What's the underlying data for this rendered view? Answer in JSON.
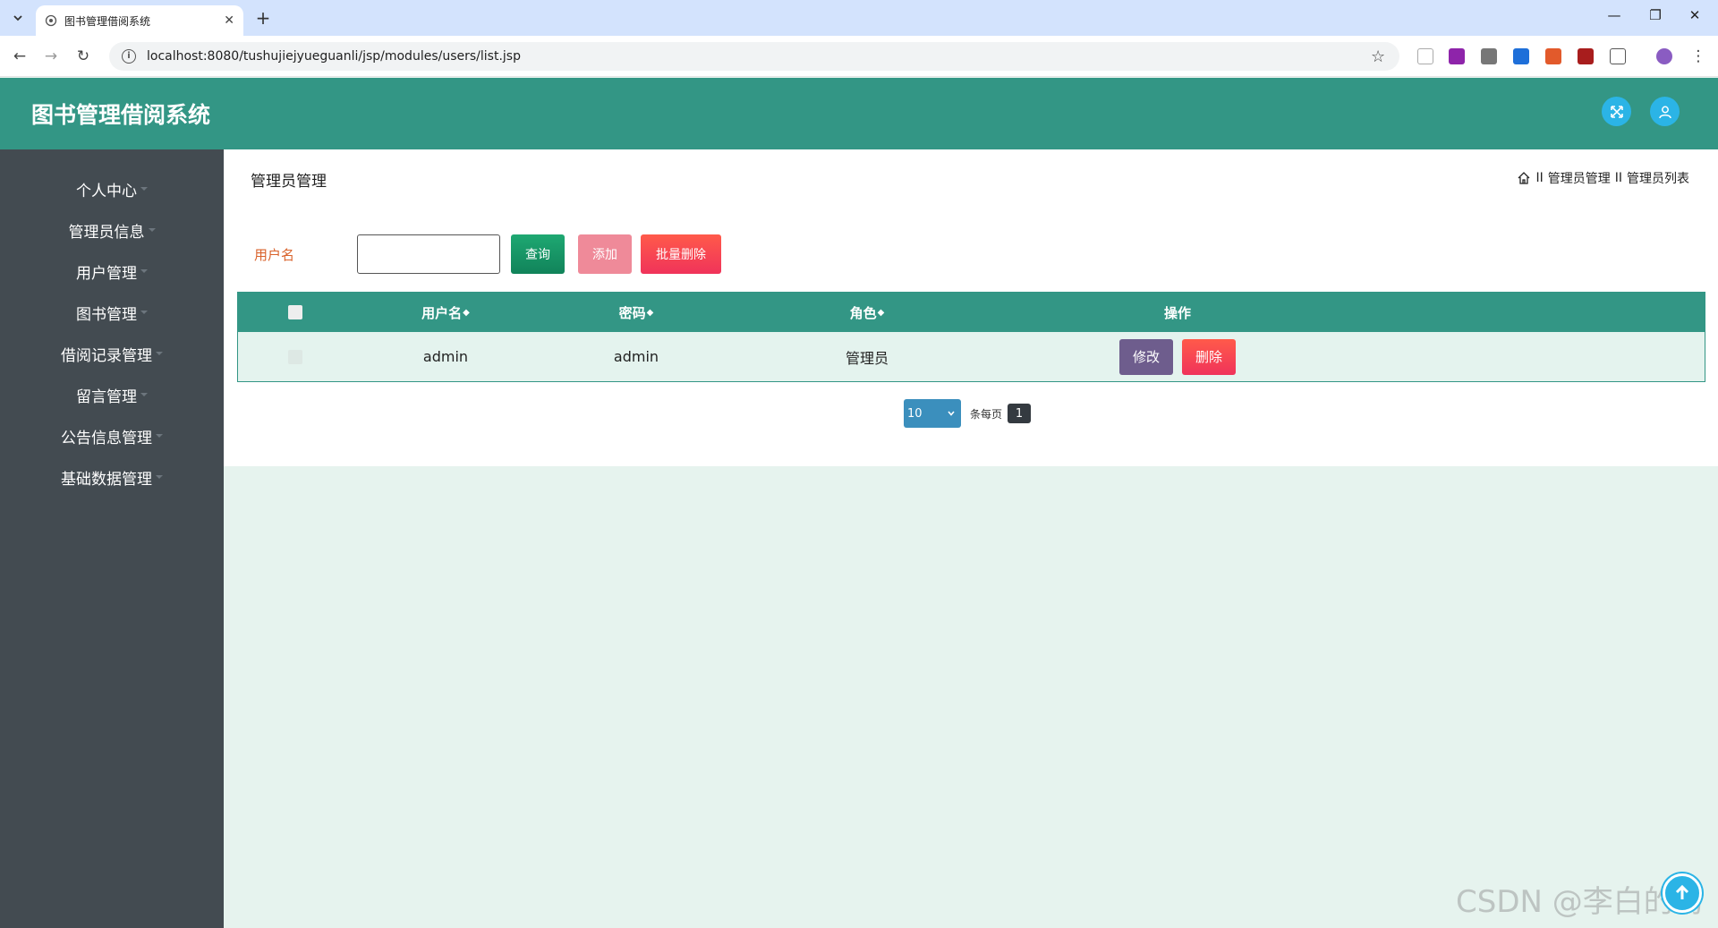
{
  "browser": {
    "tab_title": "图书管理借阅系统",
    "tab_close": "✕",
    "new_tab": "+",
    "url": "localhost:8080/tushujiejyueguanli/jsp/modules/users/list.jsp",
    "minimize": "—",
    "restore": "❐",
    "close": "✕"
  },
  "app": {
    "title": "图书管理借阅系统",
    "accent_color": "#339685",
    "sidebar_color": "#434b51"
  },
  "sidebar": {
    "items": [
      {
        "label": "个人中心"
      },
      {
        "label": "管理员信息"
      },
      {
        "label": "用户管理"
      },
      {
        "label": "图书管理"
      },
      {
        "label": "借阅记录管理"
      },
      {
        "label": "留言管理"
      },
      {
        "label": "公告信息管理"
      },
      {
        "label": "基础数据管理"
      }
    ]
  },
  "page": {
    "title": "管理员管理",
    "breadcrumb": [
      "管理员管理",
      "管理员列表"
    ],
    "breadcrumb_sep": "II"
  },
  "search": {
    "label": "用户名",
    "value": "",
    "query_label": "查询",
    "add_label": "添加",
    "batch_delete_label": "批量删除"
  },
  "table": {
    "columns": [
      "用户名",
      "密码",
      "角色",
      "操作"
    ],
    "sort_icon": "◆",
    "rows": [
      {
        "username": "admin",
        "password": "admin",
        "role": "管理员"
      }
    ],
    "edit_label": "修改",
    "delete_label": "删除"
  },
  "pager": {
    "page_size": "10",
    "per_page_label": "条每页",
    "current_page": "1"
  },
  "watermark": "CSDN @李白的粉"
}
